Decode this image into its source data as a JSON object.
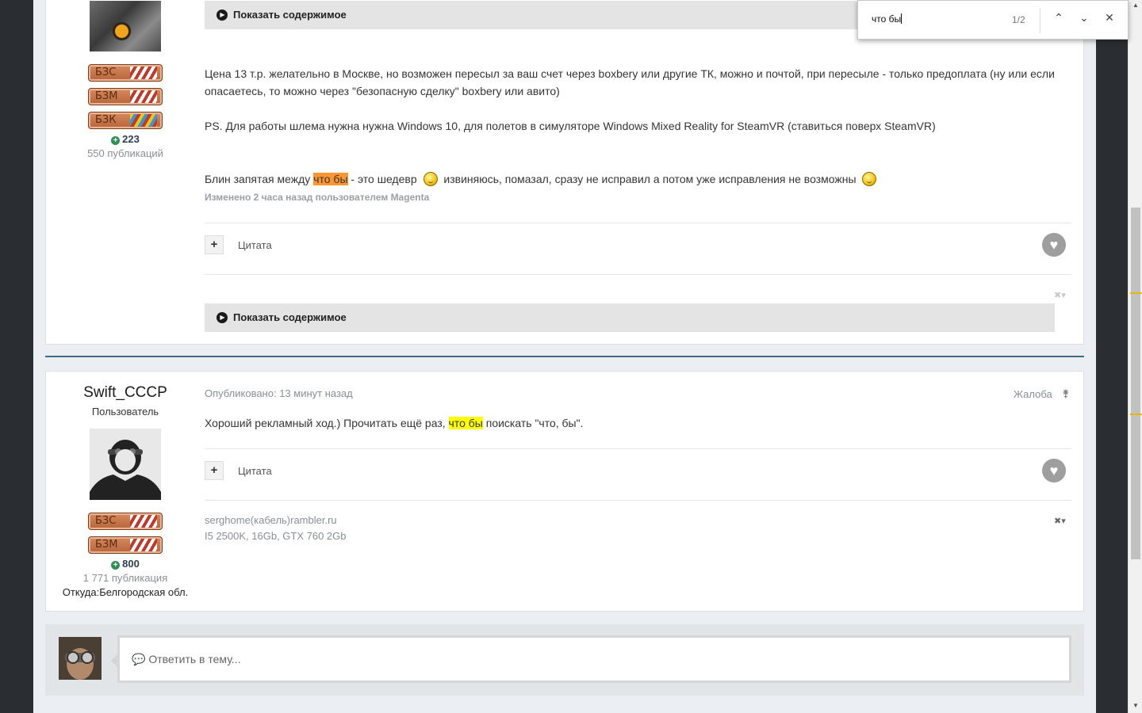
{
  "findbar": {
    "query": "что бы",
    "count": "1/2",
    "prev_icon": "chevron-up-icon",
    "next_icon": "chevron-down-icon",
    "close_icon": "close-icon"
  },
  "post1": {
    "badges": [
      "БЗС",
      "БЗМ",
      "БЗК"
    ],
    "reputation": "223",
    "posts_count": "550 публикаций",
    "spoiler_top": "Показать содержимое",
    "paragraph1": "Цена 13 т.р. желательно в Москве,  но возможен пересыл за ваш счет через boxbery или другие ТК, можно и почтой, при пересыле - только предоплата (ну или если опасаетесь, то можно через \"безопасную сделку\"  boxbery или авито)",
    "paragraph2": "PS. Для работы шлема нужна нужна Windows 10, для полетов в симуляторе Windows Mixed Reality for SteamVR (ставиться поверх SteamVR)",
    "p3_before": "Блин запятая между ",
    "p3_highlight": "что бы",
    "p3_middle": " - это шедевр ",
    "p3_after": " извиняюсь, помазал, сразу не исправил а потом уже исправления не возможны ",
    "edited": "Изменено 2 часа назад пользователем Magenta",
    "quote": "Цитата",
    "spoiler_bottom": "Показать содержимое"
  },
  "post2": {
    "username": "Swift_CCCP",
    "user_title": "Пользователь",
    "badges": [
      "БЗС",
      "БЗМ"
    ],
    "reputation": "800",
    "posts_count": "1 771 публикация",
    "location": "Откуда:Белгородская обл.",
    "posted": "Опубликовано: 13 минут назад",
    "report": "Жалоба",
    "text_before": "Хороший рекламный ход.) Прочитать ещё раз, ",
    "text_highlight": "что бы",
    "text_after": " поискать \"что, бы\".",
    "quote": "Цитата",
    "signature_line1": "serghome(кабель)rambler.ru",
    "signature_line2": "I5 2500K, 16Gb, GTX 760 2Gb"
  },
  "reply": {
    "placeholder": "Ответить в тему..."
  },
  "colors": {
    "highlight": "#ffff00",
    "active_highlight": "#ff9632",
    "separator": "#3d6a7f"
  }
}
